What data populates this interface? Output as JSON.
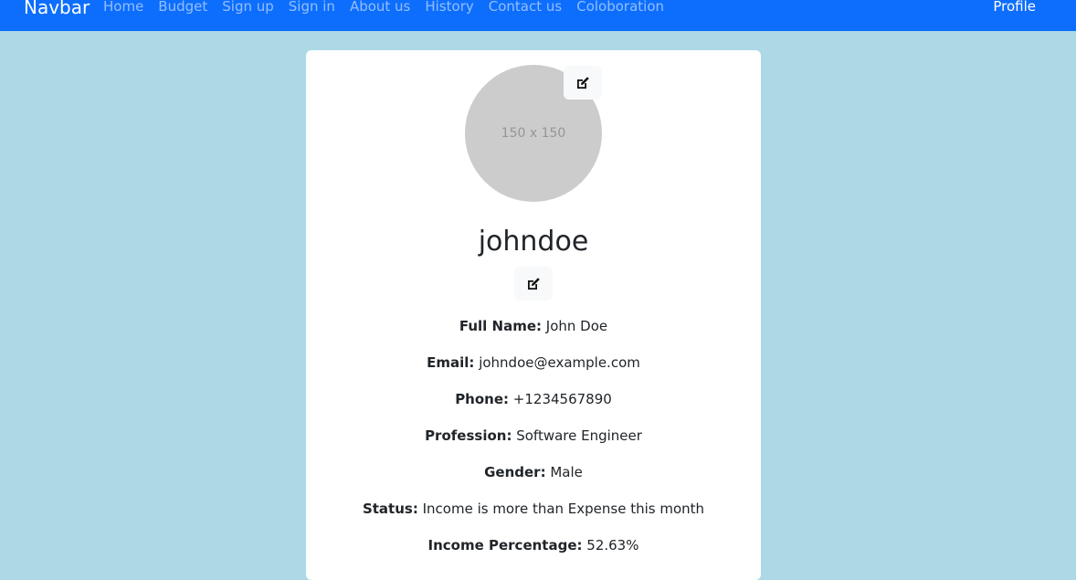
{
  "navbar": {
    "brand": "Navbar",
    "links": [
      "Home",
      "Budget",
      "Sign up",
      "Sign in",
      "About us",
      "History",
      "Contact us",
      "Coloboration"
    ],
    "profile": "Profile"
  },
  "profile": {
    "avatar_placeholder": "150 x 150",
    "username": "johndoe",
    "fields": [
      {
        "label": "Full Name:",
        "value": "John Doe"
      },
      {
        "label": "Email:",
        "value": "johndoe@example.com"
      },
      {
        "label": "Phone:",
        "value": "+1234567890"
      },
      {
        "label": "Profession:",
        "value": "Software Engineer"
      },
      {
        "label": "Gender:",
        "value": "Male"
      },
      {
        "label": "Status:",
        "value": "Income is more than Expense this month"
      },
      {
        "label": "Income Percentage:",
        "value": "52.63%"
      }
    ]
  },
  "colors": {
    "navbar": "#0d6efd",
    "background": "#add8e6"
  }
}
